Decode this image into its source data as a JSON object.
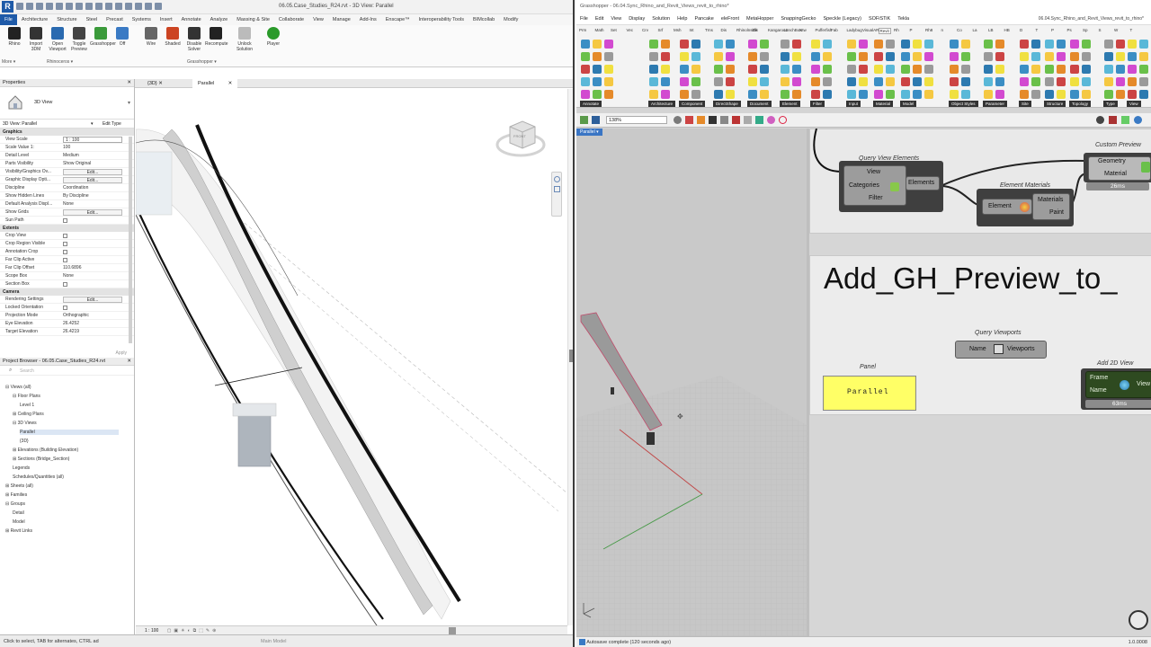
{
  "revit": {
    "doc_title": "06.05.Case_Studies_R24.rvt - 3D View: Parallel",
    "tabs": [
      "File",
      "Architecture",
      "Structure",
      "Steel",
      "Precast",
      "Systems",
      "Insert",
      "Annotate",
      "Analyze",
      "Massing & Site",
      "Collaborate",
      "View",
      "Manage",
      "Add-Ins",
      "Enscape™",
      "Interoperability Tools",
      "BIMcollab",
      "Modify"
    ],
    "ribbon": {
      "buttons": [
        "Rhino",
        "Import 3DM",
        "Open Viewport",
        "Toggle Preview",
        "Grasshopper",
        "Off",
        "Wire",
        "Shaded",
        "Disable Solver",
        "Recompute",
        "Unlock Solution",
        "Player"
      ],
      "group_rhino": "Rhinoceros ▾",
      "group_gh": "Grasshopper ▾",
      "more": "More ▾"
    },
    "view_tabs": [
      "{3D}",
      "Parallel"
    ],
    "properties": {
      "title": "Properties",
      "type_name": "3D View",
      "instance": "3D View: Parallel",
      "edit_type": "Edit Type",
      "sections": {
        "graphics": "Graphics",
        "extents": "Extents",
        "camera": "Camera"
      },
      "graphics_rows": [
        {
          "k": "View Scale",
          "v": "1 : 100"
        },
        {
          "k": "Scale Value    1:",
          "v": "100"
        },
        {
          "k": "Detail Level",
          "v": "Medium"
        },
        {
          "k": "Parts Visibility",
          "v": "Show Original"
        },
        {
          "k": "Visibility/Graphics Ov...",
          "v": "Edit..."
        },
        {
          "k": "Graphic Display Opti...",
          "v": "Edit..."
        },
        {
          "k": "Discipline",
          "v": "Coordination"
        },
        {
          "k": "Show Hidden Lines",
          "v": "By Discipline"
        },
        {
          "k": "Default Analysis Displ...",
          "v": "None"
        },
        {
          "k": "Show Grids",
          "v": "Edit..."
        },
        {
          "k": "Sun Path",
          "v": ""
        }
      ],
      "extents_rows": [
        {
          "k": "Crop View",
          "v": ""
        },
        {
          "k": "Crop Region Visible",
          "v": ""
        },
        {
          "k": "Annotation Crop",
          "v": ""
        },
        {
          "k": "Far Clip Active",
          "v": ""
        },
        {
          "k": "Far Clip Offset",
          "v": "110.6896"
        },
        {
          "k": "Scope Box",
          "v": "None"
        },
        {
          "k": "Section Box",
          "v": ""
        }
      ],
      "camera_rows": [
        {
          "k": "Rendering Settings",
          "v": "Edit..."
        },
        {
          "k": "Locked Orientation",
          "v": ""
        },
        {
          "k": "Projection Mode",
          "v": "Orthographic"
        },
        {
          "k": "Eye Elevation",
          "v": "26.4252"
        },
        {
          "k": "Target Elevation",
          "v": "26.4219"
        }
      ],
      "apply": "Apply"
    },
    "browser": {
      "title": "Project Browser - 06.05.Case_Studies_R24.rvt",
      "search_placeholder": "Search",
      "items": [
        "Views (all)",
        "Floor Plans",
        "Level 1",
        "Ceiling Plans",
        "3D Views",
        "Parallel",
        "{3D}",
        "Elevations (Building Elevation)",
        "Sections (Bridge_Section)",
        "Legends",
        "Schedules/Quantities (all)",
        "Sheets (all)",
        "Families",
        "Groups",
        "Detail",
        "Model",
        "Revit Links"
      ]
    },
    "view_scale": "1 : 100",
    "main_model": "Main Model",
    "status": "Click to select, TAB for alternates, CTRL ad",
    "viewcube_label": "FRONT"
  },
  "gh": {
    "title": "Grasshopper - 06.04.Sync_Rhino_and_Revit_Views_revit_to_rhino*",
    "doc_right": "06.04.Sync_Rhino_and_Revit_Views_revit_to_rhino*",
    "menu": [
      "File",
      "Edit",
      "View",
      "Display",
      "Solution",
      "Help",
      "Pancake",
      "eleFront",
      "MetaHopper",
      "SnappingGecko",
      "Speckle (Legacy)",
      "SOFiSTiK",
      "Tekla"
    ],
    "tabs": [
      "Prm",
      "Math",
      "Set",
      "Vec",
      "Crv",
      "Srf",
      "Msh",
      "Int",
      "Trns",
      "Dis",
      "Rhinolnside",
      "Elk",
      "Kangaroo2",
      "LunchBox",
      "Ntw",
      "Pufferfish",
      "Fab",
      "Ladybug",
      "VisualARQ",
      "Revit",
      "Rh",
      "P",
      "Rh8",
      "n",
      "Co",
      "La",
      "LB",
      "HB",
      "D",
      "T",
      "P",
      "Ps",
      "Sp",
      "S",
      "W",
      "T"
    ],
    "group_labels": [
      "Annotate",
      "Architecture",
      "Component",
      "DirectShape",
      "Document",
      "Element",
      "Filter",
      "Input",
      "Material",
      "Model",
      "Object Styles",
      "Parameter",
      "Site",
      "Structure",
      "Topology",
      "Type",
      "View"
    ],
    "zoom": "138%",
    "viewport_label": "Parallel",
    "components": {
      "query_view_elements": {
        "caption": "Query View Elements",
        "in": [
          "View",
          "Categories",
          "Filter"
        ],
        "out": "Elements"
      },
      "element_materials": {
        "caption": "Element Materials",
        "in": "Element",
        "out": [
          "Materials",
          "Paint"
        ]
      },
      "custom_preview": {
        "caption": "Custom Preview",
        "in": [
          "Geometry",
          "Material"
        ],
        "time": "26ms"
      },
      "big_title": "Add_GH_Preview_to_",
      "query_viewports": {
        "caption": "Query Viewports",
        "in": "Name",
        "out": "Viewports"
      },
      "panel": {
        "caption": "Panel",
        "text": "Parallel"
      },
      "add_2d_view": {
        "caption": "Add 2D View",
        "in": [
          "Frame",
          "Name"
        ],
        "out": "View",
        "time": "63ms"
      }
    },
    "status": "Autosave complete (120 seconds ago)",
    "version": "1.0.0008"
  },
  "colors": {
    "revit_blue": "#1e5aa8",
    "panel_yellow": "#ffff66",
    "wire_green": "#a8e08a",
    "gh_green_component": "#2e4a20",
    "viewport_grid": "#c2c2c2"
  }
}
